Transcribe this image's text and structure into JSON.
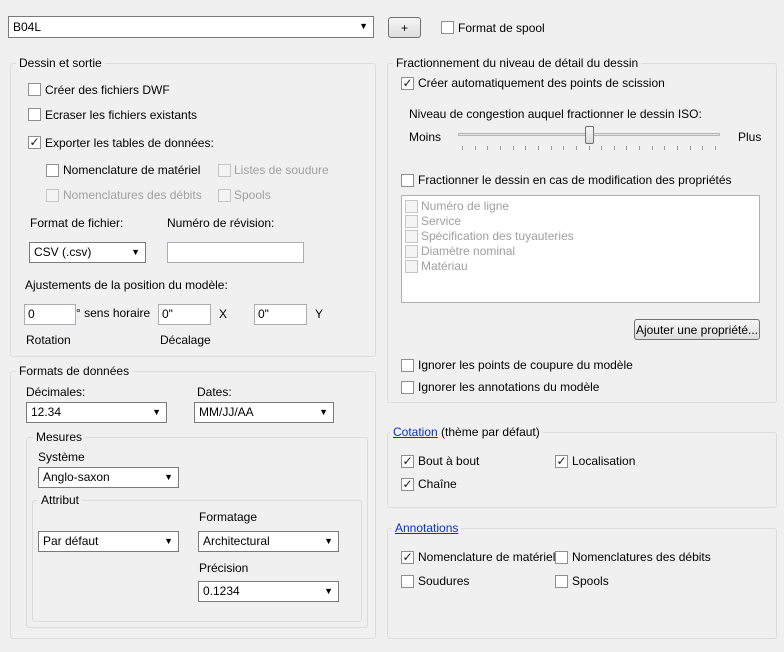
{
  "top": {
    "name_value": "B04L",
    "plus_label": "+",
    "spool_format_label": "Format de spool"
  },
  "drawing": {
    "title": "Dessin et sortie",
    "create_dwf_label": "Créer des fichiers DWF",
    "overwrite_label": "Ecraser les fichiers existants",
    "export_tables_label": "Exporter les tables de données:",
    "bom_label": "Nomenclature de matériel",
    "weld_lists_label": "Listes de soudure",
    "cut_lists_label": "Nomenclatures des débits",
    "spools_label": "Spools",
    "file_format_label": "Format de fichier:",
    "file_format_value": "CSV (.csv)",
    "revision_label": "Numéro de révision:",
    "revision_value": "",
    "model_position_label": "Ajustements de la position du modèle:",
    "rotation_value": "0",
    "clockwise_label": "° sens horaire",
    "offset_x_value": "0\"",
    "x_label": "X",
    "offset_y_value": "0\"",
    "y_label": "Y",
    "rotation_label": "Rotation",
    "offset_label": "Décalage"
  },
  "formats": {
    "title": "Formats de données",
    "decimals_label": "Décimales:",
    "decimals_value": "12.34",
    "dates_label": "Dates:",
    "dates_value": "MM/JJ/AA",
    "measures_title": "Mesures",
    "system_label": "Système",
    "system_value": "Anglo-saxon",
    "attribute_title": "Attribut",
    "attribute_value": "Par défaut",
    "formatting_label": "Formatage",
    "formatting_value": "Architectural",
    "precision_label": "Précision",
    "precision_value": "0.1234"
  },
  "split": {
    "title": "Fractionnement du niveau de détail du dessin",
    "auto_split_label": "Créer automatiquement des points de scission",
    "congestion_label": "Niveau de congestion auquel fractionner le dessin ISO:",
    "less_label": "Moins",
    "more_label": "Plus",
    "congestion_level": 0.5,
    "split_on_change_label": "Fractionner le dessin en cas de modification des propriétés",
    "properties": [
      "Numéro de ligne",
      "Service",
      "Spécification des tuyauteries",
      "Diamètre nominal",
      "Matériau"
    ],
    "add_property_label": "Ajouter une propriété...",
    "ignore_breakpoints_label": "Ignorer les points de coupure du modèle",
    "ignore_annotations_label": "Ignorer les annotations du modèle"
  },
  "dimension": {
    "link_label": "Cotation",
    "suffix": "(thème par défaut)",
    "end_to_end_label": "Bout à bout",
    "location_label": "Localisation",
    "chain_label": "Chaîne"
  },
  "annotations": {
    "link_label": "Annotations",
    "bom_label": "Nomenclature de matériel",
    "cut_lists_label": "Nomenclatures des débits",
    "welds_label": "Soudures",
    "spools_label": "Spools"
  }
}
